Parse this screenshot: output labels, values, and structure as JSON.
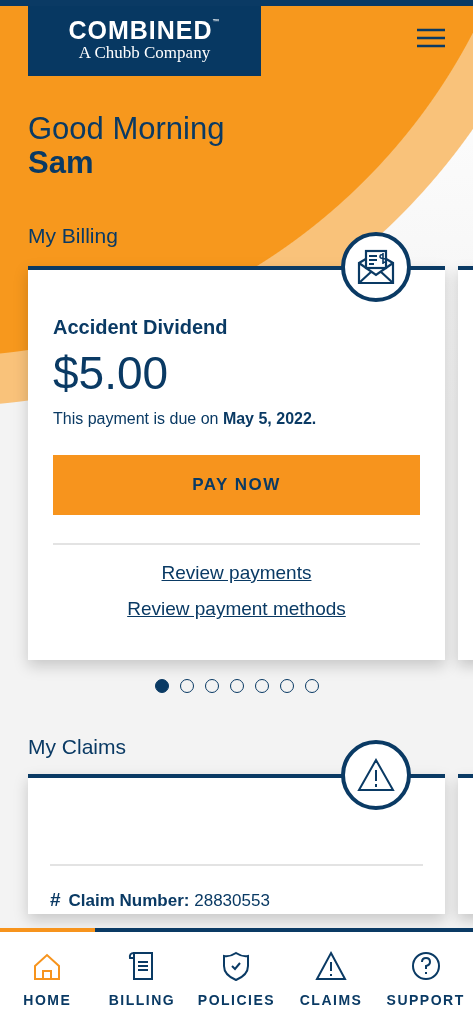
{
  "header": {
    "brand": "COMBINED",
    "trademark": "™",
    "tagline": "A Chubb Company"
  },
  "greeting": {
    "salutation": "Good Morning",
    "name": "Sam"
  },
  "billing": {
    "title": "My Billing",
    "card": {
      "policy": "Accident Dividend",
      "amount": "$5.00",
      "due_text": "This payment is due on **May 5, 2022.**",
      "pay_button": "PAY NOW",
      "links": [
        "Review payments",
        "Review payment methods"
      ]
    },
    "pager": [
      {
        "selected": true
      },
      {
        "selected": false
      },
      {
        "selected": false
      },
      {
        "selected": false
      },
      {
        "selected": false
      },
      {
        "selected": false
      },
      {
        "selected": false
      }
    ]
  },
  "claims": {
    "title": "My Claims",
    "card": {
      "number_mark": "#",
      "claim_number": "**Claim Number:** 28830553"
    }
  },
  "bottom_nav": [
    {
      "label": "HOME",
      "selected": true
    },
    {
      "label": "BILLING",
      "selected": false
    },
    {
      "label": "POLICIES",
      "selected": false
    },
    {
      "label": "CLAIMS",
      "selected": false
    },
    {
      "label": "SUPPORT",
      "selected": false
    }
  ]
}
